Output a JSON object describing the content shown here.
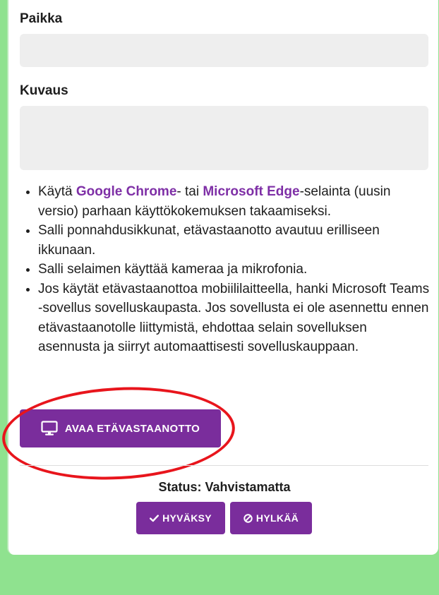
{
  "form": {
    "place_label": "Paikka",
    "place_value": "",
    "description_label": "Kuvaus",
    "description_value": ""
  },
  "instructions": {
    "item1_prefix": "Käytä ",
    "browser1": "Google Chrome",
    "item1_mid": "- tai ",
    "browser2": "Microsoft Edge",
    "item1_suffix": "-selainta (uusin versio) parhaan käyttökokemuksen takaamiseksi.",
    "item2": "Salli ponnahdusikkunat, etävastaanotto avautuu erilliseen ikkunaan.",
    "item3": "Salli selaimen käyttää kameraa ja mikrofonia.",
    "item4": "Jos käytät etävastaanottoa mobiililaitteella, hanki Microsoft Teams -sovellus sovelluskaupasta. Jos sovellusta ei ole asennettu ennen etävastaanotolle liittymistä, ehdottaa selain sovelluksen asennusta ja siirryt automaattisesti sovelluskauppaan."
  },
  "open_button": {
    "label": "AVAA ETÄVASTAANOTTO",
    "icon": "monitor-icon"
  },
  "status": {
    "text": "Status: Vahvistamatta"
  },
  "actions": {
    "accept_label": "HYVÄKSY",
    "accept_icon": "check-icon",
    "reject_label": "HYLKÄÄ",
    "reject_icon": "ban-icon"
  },
  "colors": {
    "accent": "#7a2d9c",
    "page_background": "#8fe28f",
    "field_background": "#eeeeee",
    "annotation": "#e8151c"
  }
}
